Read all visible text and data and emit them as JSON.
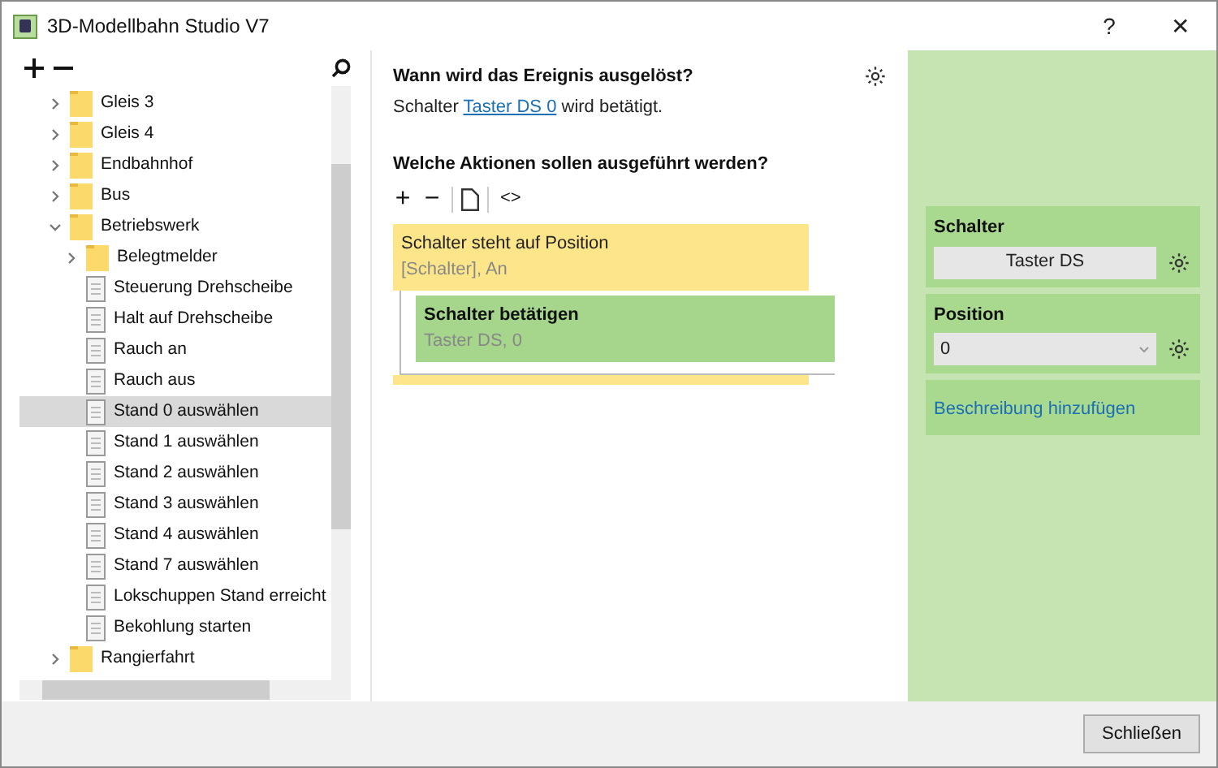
{
  "window": {
    "title": "3D-Modellbahn Studio V7",
    "help": "?",
    "close": "✕"
  },
  "tree": {
    "items": [
      {
        "kind": "folder",
        "label": "Gleis 3",
        "expanded": false,
        "selected": false
      },
      {
        "kind": "folder",
        "label": "Gleis 4",
        "expanded": false,
        "selected": false
      },
      {
        "kind": "folder",
        "label": "Endbahnhof",
        "expanded": false,
        "selected": false
      },
      {
        "kind": "folder",
        "label": "Bus",
        "expanded": false,
        "selected": false
      },
      {
        "kind": "folder",
        "label": "Betriebswerk",
        "expanded": true,
        "selected": false,
        "children": [
          {
            "kind": "folder",
            "label": "Belegtmelder",
            "expanded": false,
            "selected": false
          },
          {
            "kind": "file",
            "label": "Steuerung Drehscheibe",
            "selected": false
          },
          {
            "kind": "file",
            "label": "Halt auf Drehscheibe",
            "selected": false
          },
          {
            "kind": "file",
            "label": "Rauch an",
            "selected": false
          },
          {
            "kind": "file",
            "label": "Rauch aus",
            "selected": false
          },
          {
            "kind": "file",
            "label": "Stand 0 auswählen",
            "selected": true
          },
          {
            "kind": "file",
            "label": "Stand 1 auswählen",
            "selected": false
          },
          {
            "kind": "file",
            "label": "Stand 2 auswählen",
            "selected": false
          },
          {
            "kind": "file",
            "label": "Stand 3 auswählen",
            "selected": false
          },
          {
            "kind": "file",
            "label": "Stand 4 auswählen",
            "selected": false
          },
          {
            "kind": "file",
            "label": "Stand 7 auswählen",
            "selected": false
          },
          {
            "kind": "file",
            "label": "Lokschuppen Stand erreicht",
            "selected": false
          },
          {
            "kind": "file",
            "label": "Bekohlung starten",
            "selected": false
          }
        ]
      },
      {
        "kind": "folder",
        "label": "Rangierfahrt",
        "expanded": false,
        "selected": false
      }
    ]
  },
  "trigger": {
    "heading": "Wann wird das Ereignis ausgelöst?",
    "text_before": "Schalter",
    "link": "Taster DS 0",
    "text_after": "wird betätigt."
  },
  "actions": {
    "heading": "Welche Aktionen sollen ausgeführt werden?",
    "toolbar": [
      "+",
      "−",
      "<>"
    ],
    "blocks": [
      {
        "kind": "condition",
        "title": "Schalter steht auf Position",
        "detail": "[Schalter], An",
        "selected": false,
        "children": [
          {
            "kind": "action",
            "title": "Schalter betätigen",
            "detail": "Taster DS, 0",
            "selected": true
          }
        ]
      }
    ]
  },
  "properties": {
    "fields": [
      {
        "kind": "button",
        "label": "Schalter",
        "value": "Taster DS"
      },
      {
        "kind": "select",
        "label": "Position",
        "value": "0"
      }
    ],
    "link": "Beschreibung hinzufügen"
  },
  "footer": {
    "button": "Schließen"
  }
}
